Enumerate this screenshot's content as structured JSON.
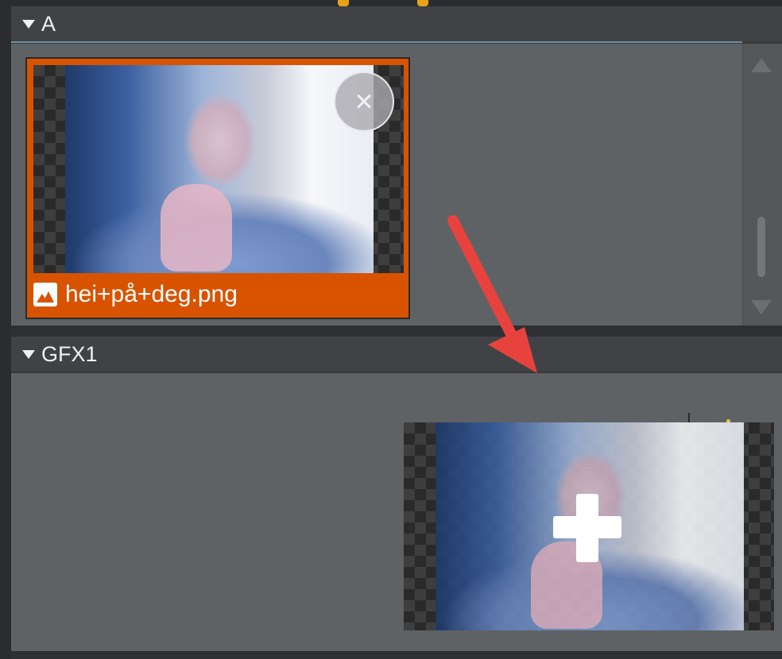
{
  "sections": {
    "a": {
      "title": "A"
    },
    "gfx1": {
      "title": "GFX1"
    }
  },
  "card": {
    "filename": "hei+på+deg.png",
    "icon": "image-icon",
    "remove_icon": "close-icon",
    "selected": true
  },
  "drag": {
    "indicator_icon": "plus-icon"
  },
  "colors": {
    "card_accent": "#d85300",
    "panel_bg": "#5f6265",
    "header_bg": "#404245",
    "arrow": "#e8423e"
  },
  "glyphs": {
    "close": "×"
  }
}
